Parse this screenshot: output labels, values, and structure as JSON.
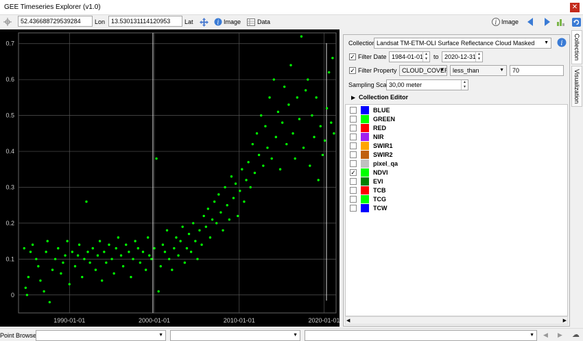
{
  "window": {
    "title": "GEE Timeseries Explorer (v1.0)",
    "close_glyph": "✕"
  },
  "toolbar": {
    "lon_value": "52.436688729539284",
    "lon_label": "Lon",
    "lat_value": "13.530131114120953",
    "lat_label": "Lat",
    "image_label": "Image",
    "data_label": "Data",
    "right_image_label": "Image"
  },
  "panel": {
    "collection_label": "Collection",
    "collection_value": "Landsat TM-ETM-OLI Surface Reflectance Cloud Masked",
    "filter_date_label": "Filter Date",
    "filter_date_checked": "✓",
    "date_from": "1984-01-01",
    "date_to_label": "to",
    "date_to": "2020-12-31",
    "filter_property_label": "Filter Property",
    "filter_property_checked": "✓",
    "property_value": "CLOUD_COVER",
    "operator_value": "less_than",
    "threshold_value": "70",
    "sampling_scale_label": "Sampling Scale",
    "sampling_scale_value": "30,00 meter",
    "collection_editor_label": "Collection Editor",
    "bands": [
      {
        "name": "BLUE",
        "color": "#0000ff",
        "checked": ""
      },
      {
        "name": "GREEN",
        "color": "#00ff00",
        "checked": ""
      },
      {
        "name": "RED",
        "color": "#ff0000",
        "checked": ""
      },
      {
        "name": "NIR",
        "color": "#a020f0",
        "checked": ""
      },
      {
        "name": "SWIR1",
        "color": "#ffa500",
        "checked": ""
      },
      {
        "name": "SWIR2",
        "color": "#c06010",
        "checked": ""
      },
      {
        "name": "pixel_qa",
        "color": "#c0c0c0",
        "checked": ""
      },
      {
        "name": "NDVI",
        "color": "#00ff00",
        "checked": "✓"
      },
      {
        "name": "EVI",
        "color": "#008000",
        "checked": ""
      },
      {
        "name": "TCB",
        "color": "#ff0000",
        "checked": ""
      },
      {
        "name": "TCG",
        "color": "#00ff00",
        "checked": ""
      },
      {
        "name": "TCW",
        "color": "#0000ff",
        "checked": ""
      }
    ]
  },
  "side_tabs": {
    "collection": "Collection",
    "visualization": "Visualization"
  },
  "statusbar": {
    "point_browser_label": "Point Browser"
  },
  "chart_data": {
    "type": "scatter",
    "x_axis_type": "date",
    "xlim": [
      "1984-01-01",
      "2021-06-01"
    ],
    "ylim": [
      -0.05,
      0.73
    ],
    "x_ticks": [
      "1990-01-01",
      "2000-01-01",
      "2010-01-01",
      "2020-01-01"
    ],
    "y_ticks": [
      0,
      0.1,
      0.2,
      0.3,
      0.4,
      0.5,
      0.6,
      0.7
    ],
    "y_tick_labels": [
      "0",
      "0.1",
      "0.2",
      "0.3",
      "0.4",
      "0.5",
      "0.6",
      "0.7"
    ],
    "grid": true,
    "point_color": "#00ff00",
    "current_date_marker": "1999-11-01",
    "series": [
      {
        "points": [
          [
            "1984-09-01",
            0.13
          ],
          [
            "1984-11-01",
            0.02
          ],
          [
            "1985-01-01",
            0.0
          ],
          [
            "1985-03-01",
            0.05
          ],
          [
            "1985-06-01",
            0.12
          ],
          [
            "1985-09-01",
            0.14
          ],
          [
            "1986-02-01",
            0.1
          ],
          [
            "1986-05-01",
            0.08
          ],
          [
            "1986-08-01",
            0.04
          ],
          [
            "1987-01-01",
            0.01
          ],
          [
            "1987-04-01",
            0.12
          ],
          [
            "1987-06-01",
            0.15
          ],
          [
            "1987-09-01",
            -0.02
          ],
          [
            "1988-01-01",
            0.07
          ],
          [
            "1988-05-01",
            0.1
          ],
          [
            "1988-09-01",
            0.13
          ],
          [
            "1989-01-01",
            0.06
          ],
          [
            "1989-04-01",
            0.09
          ],
          [
            "1989-07-01",
            0.11
          ],
          [
            "1989-10-01",
            0.15
          ],
          [
            "1990-01-01",
            0.03
          ],
          [
            "1990-05-01",
            0.12
          ],
          [
            "1990-09-01",
            0.08
          ],
          [
            "1991-01-01",
            0.11
          ],
          [
            "1991-03-01",
            0.14
          ],
          [
            "1991-07-01",
            0.05
          ],
          [
            "1991-10-01",
            0.1
          ],
          [
            "1992-01-01",
            0.26
          ],
          [
            "1992-03-01",
            0.12
          ],
          [
            "1992-06-01",
            0.09
          ],
          [
            "1992-10-01",
            0.13
          ],
          [
            "1993-02-01",
            0.07
          ],
          [
            "1993-05-01",
            0.11
          ],
          [
            "1993-08-01",
            0.15
          ],
          [
            "1993-11-01",
            0.04
          ],
          [
            "1994-02-01",
            0.12
          ],
          [
            "1994-05-01",
            0.09
          ],
          [
            "1994-09-01",
            0.14
          ],
          [
            "1995-01-01",
            0.1
          ],
          [
            "1995-04-01",
            0.06
          ],
          [
            "1995-07-01",
            0.13
          ],
          [
            "1995-10-01",
            0.16
          ],
          [
            "1996-02-01",
            0.11
          ],
          [
            "1996-05-01",
            0.08
          ],
          [
            "1996-09-01",
            0.14
          ],
          [
            "1997-01-01",
            0.12
          ],
          [
            "1997-04-01",
            0.05
          ],
          [
            "1997-07-01",
            0.1
          ],
          [
            "1997-10-01",
            0.15
          ],
          [
            "1998-02-01",
            0.13
          ],
          [
            "1998-05-01",
            0.09
          ],
          [
            "1998-09-01",
            0.12
          ],
          [
            "1999-01-01",
            0.07
          ],
          [
            "1999-04-01",
            0.16
          ],
          [
            "1999-06-01",
            0.11
          ],
          [
            "1999-09-01",
            0.1
          ],
          [
            "2000-01-01",
            0.13
          ],
          [
            "2000-04-01",
            0.38
          ],
          [
            "2000-07-01",
            0.01
          ],
          [
            "2000-10-01",
            0.08
          ],
          [
            "2001-01-01",
            0.14
          ],
          [
            "2001-04-01",
            0.12
          ],
          [
            "2001-07-01",
            0.18
          ],
          [
            "2001-10-01",
            0.1
          ],
          [
            "2002-02-01",
            0.07
          ],
          [
            "2002-05-01",
            0.13
          ],
          [
            "2002-08-01",
            0.16
          ],
          [
            "2002-11-01",
            0.11
          ],
          [
            "2003-02-01",
            0.15
          ],
          [
            "2003-05-01",
            0.19
          ],
          [
            "2003-08-01",
            0.09
          ],
          [
            "2003-11-01",
            0.13
          ],
          [
            "2004-02-01",
            0.17
          ],
          [
            "2004-05-01",
            0.12
          ],
          [
            "2004-08-01",
            0.2
          ],
          [
            "2004-11-01",
            0.15
          ],
          [
            "2005-02-01",
            0.1
          ],
          [
            "2005-05-01",
            0.18
          ],
          [
            "2005-08-01",
            0.14
          ],
          [
            "2005-11-01",
            0.22
          ],
          [
            "2006-02-01",
            0.19
          ],
          [
            "2006-05-01",
            0.24
          ],
          [
            "2006-08-01",
            0.16
          ],
          [
            "2006-11-01",
            0.21
          ],
          [
            "2007-02-01",
            0.26
          ],
          [
            "2007-05-01",
            0.2
          ],
          [
            "2007-08-01",
            0.28
          ],
          [
            "2007-11-01",
            0.23
          ],
          [
            "2008-02-01",
            0.18
          ],
          [
            "2008-05-01",
            0.3
          ],
          [
            "2008-08-01",
            0.25
          ],
          [
            "2008-11-01",
            0.21
          ],
          [
            "2009-02-01",
            0.33
          ],
          [
            "2009-05-01",
            0.27
          ],
          [
            "2009-08-01",
            0.31
          ],
          [
            "2009-11-01",
            0.22
          ],
          [
            "2010-02-01",
            0.29
          ],
          [
            "2010-05-01",
            0.35
          ],
          [
            "2010-08-01",
            0.26
          ],
          [
            "2010-11-01",
            0.32
          ],
          [
            "2011-02-01",
            0.37
          ],
          [
            "2011-05-01",
            0.3
          ],
          [
            "2011-08-01",
            0.42
          ],
          [
            "2011-11-01",
            0.34
          ],
          [
            "2012-02-01",
            0.45
          ],
          [
            "2012-05-01",
            0.39
          ],
          [
            "2012-08-01",
            0.5
          ],
          [
            "2012-11-01",
            0.36
          ],
          [
            "2013-02-01",
            0.47
          ],
          [
            "2013-05-01",
            0.41
          ],
          [
            "2013-08-01",
            0.55
          ],
          [
            "2013-11-01",
            0.38
          ],
          [
            "2014-02-01",
            0.6
          ],
          [
            "2014-05-01",
            0.44
          ],
          [
            "2014-08-01",
            0.51
          ],
          [
            "2014-11-01",
            0.35
          ],
          [
            "2015-02-01",
            0.48
          ],
          [
            "2015-05-01",
            0.58
          ],
          [
            "2015-08-01",
            0.42
          ],
          [
            "2015-11-01",
            0.53
          ],
          [
            "2016-02-01",
            0.64
          ],
          [
            "2016-05-01",
            0.45
          ],
          [
            "2016-08-01",
            0.38
          ],
          [
            "2016-11-01",
            0.55
          ],
          [
            "2017-02-01",
            0.49
          ],
          [
            "2017-05-01",
            0.72
          ],
          [
            "2017-08-01",
            0.41
          ],
          [
            "2017-11-01",
            0.57
          ],
          [
            "2018-02-01",
            0.6
          ],
          [
            "2018-05-01",
            0.36
          ],
          [
            "2018-08-01",
            0.5
          ],
          [
            "2018-11-01",
            0.44
          ],
          [
            "2019-02-01",
            0.55
          ],
          [
            "2019-05-01",
            0.32
          ],
          [
            "2019-08-01",
            0.47
          ],
          [
            "2019-11-01",
            0.39
          ],
          [
            "2020-02-01",
            0.43
          ],
          [
            "2020-05-01",
            0.52
          ],
          [
            "2020-08-01",
            0.62
          ],
          [
            "2020-11-01",
            0.48
          ],
          [
            "2021-01-01",
            0.66
          ],
          [
            "2021-03-01",
            0.45
          ]
        ]
      }
    ]
  }
}
